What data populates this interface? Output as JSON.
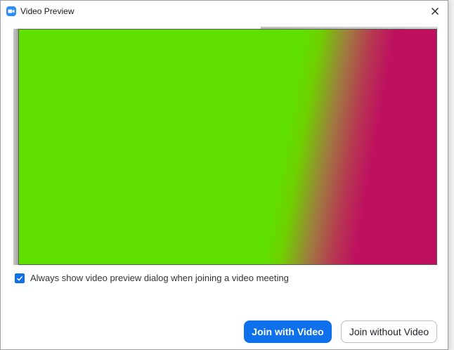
{
  "window": {
    "title": "Video Preview",
    "app_icon": "camera-icon",
    "close_icon": "close-icon"
  },
  "video": {
    "colors": {
      "left": "#5fe000",
      "right": "#bf1060"
    }
  },
  "options": {
    "always_show_label": "Always show video preview dialog when joining a video meeting",
    "always_show_checked": true
  },
  "buttons": {
    "join_with_video": "Join with Video",
    "join_without_video": "Join without Video"
  },
  "colors": {
    "accent": "#0e71eb",
    "app_icon_bg": "#2d8cff"
  }
}
